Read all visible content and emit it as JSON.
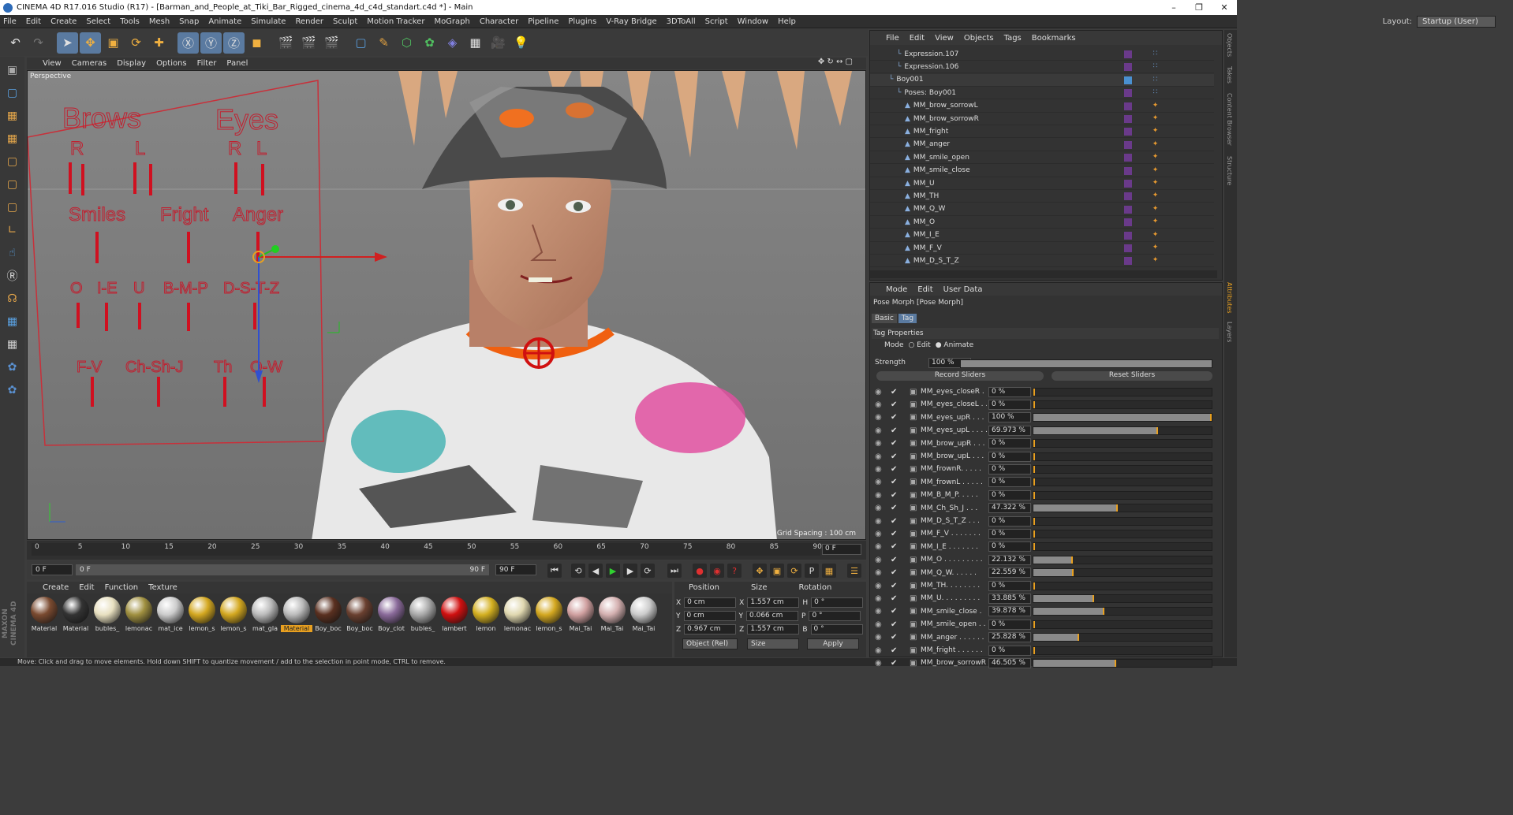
{
  "window": {
    "title": "CINEMA 4D R17.016 Studio (R17) - [Barman_and_People_at_Tiki_Bar_Rigged_cinema_4d_c4d_standart.c4d *] - Main"
  },
  "menubar": [
    "File",
    "Edit",
    "Create",
    "Select",
    "Tools",
    "Mesh",
    "Snap",
    "Animate",
    "Simulate",
    "Render",
    "Sculpt",
    "Motion Tracker",
    "MoGraph",
    "Character",
    "Pipeline",
    "Plugins",
    "V-Ray Bridge",
    "3DToAll",
    "Script",
    "Window",
    "Help"
  ],
  "layout": {
    "label": "Layout:",
    "value": "Startup (User)"
  },
  "viewport": {
    "menu": [
      "View",
      "Cameras",
      "Display",
      "Options",
      "Filter",
      "Panel"
    ],
    "label": "Perspective",
    "grid_spacing": "Grid Spacing : 100 cm",
    "rig_labels": {
      "brows": "Brows",
      "eyes": "Eyes",
      "r1": "R",
      "l1": "L",
      "r2": "R",
      "l2": "L",
      "smiles": "Smiles",
      "fright": "Fright",
      "anger": "Anger",
      "o": "O",
      "ie": "I-E",
      "u": "U",
      "bmp": "B-M-P",
      "dstz": "D-S-T-Z",
      "fv": "F-V",
      "chshj": "Ch-Sh-J",
      "th": "Th",
      "qw": "Q-W"
    }
  },
  "timeline": {
    "ticks": [
      "0",
      "5",
      "10",
      "15",
      "20",
      "25",
      "30",
      "35",
      "40",
      "45",
      "50",
      "55",
      "60",
      "65",
      "70",
      "75",
      "80",
      "85",
      "90"
    ],
    "current": "0 F"
  },
  "transport": {
    "start": "0 F",
    "range_start": "0 F",
    "range_end": "90 F",
    "end": "90 F"
  },
  "materials": {
    "menu": [
      "Create",
      "Edit",
      "Function",
      "Texture"
    ],
    "row1": [
      {
        "name": "Material",
        "color": "#7a4a30"
      },
      {
        "name": "Material",
        "color": "#333"
      },
      {
        "name": "bubles_",
        "color": "#e8e0c0"
      },
      {
        "name": "lemonac",
        "color": "#a09040"
      },
      {
        "name": "mat_ice",
        "color": "#ccc"
      },
      {
        "name": "lemon_s",
        "color": "#d4a820"
      },
      {
        "name": "lemon_s",
        "color": "#d4a820"
      },
      {
        "name": "mat_gla",
        "color": "#bbb"
      },
      {
        "name": "Material",
        "color": "#bbb"
      },
      {
        "name": "Boy_boc",
        "color": "#5a3020"
      },
      {
        "name": "Boy_boc",
        "color": "#6a4030"
      },
      {
        "name": "Boy_clot",
        "color": "#8a6a9a"
      },
      {
        "name": "bubles_",
        "color": "#aaa"
      },
      {
        "name": "lambert",
        "color": "#d01010"
      },
      {
        "name": "lemon",
        "color": "#d4b020"
      },
      {
        "name": "lemonac",
        "color": "#e0d8b0"
      },
      {
        "name": "lemon_s",
        "color": "#d4a820"
      },
      {
        "name": "Mai_Tai",
        "color": "#d0a0a0"
      },
      {
        "name": "Mai_Tai",
        "color": "#d4b0b0"
      },
      {
        "name": "Mai_Tai",
        "color": "#ccc"
      }
    ],
    "highlight_index": 8
  },
  "coords": {
    "headers": [
      "Position",
      "Size",
      "Rotation"
    ],
    "rows": [
      {
        "axis": "X",
        "pos": "0 cm",
        "saxis": "X",
        "size": "1.557 cm",
        "raxis": "H",
        "rot": "0 °"
      },
      {
        "axis": "Y",
        "pos": "0 cm",
        "saxis": "Y",
        "size": "0.066 cm",
        "raxis": "P",
        "rot": "0 °"
      },
      {
        "axis": "Z",
        "pos": "0.967 cm",
        "saxis": "Z",
        "size": "1.557 cm",
        "raxis": "B",
        "rot": "0 °"
      }
    ],
    "mode": "Object (Rel)",
    "size_mode": "Size",
    "apply": "Apply"
  },
  "status": "Move: Click and drag to move elements. Hold down SHIFT to quantize movement / add to the selection in point mode, CTRL to remove.",
  "objects": {
    "menu": [
      "File",
      "Edit",
      "View",
      "Objects",
      "Tags",
      "Bookmarks"
    ],
    "rows": [
      {
        "name": "Expression.107",
        "indent": 2
      },
      {
        "name": "Expression.106",
        "indent": 2
      },
      {
        "name": "Boy001",
        "indent": 1
      },
      {
        "name": "Poses: Boy001",
        "indent": 2
      },
      {
        "name": "MM_brow_sorrowL",
        "indent": 3
      },
      {
        "name": "MM_brow_sorrowR",
        "indent": 3
      },
      {
        "name": "MM_fright",
        "indent": 3
      },
      {
        "name": "MM_anger",
        "indent": 3
      },
      {
        "name": "MM_smile_open",
        "indent": 3
      },
      {
        "name": "MM_smile_close",
        "indent": 3
      },
      {
        "name": "MM_U",
        "indent": 3
      },
      {
        "name": "MM_TH",
        "indent": 3
      },
      {
        "name": "MM_Q_W",
        "indent": 3
      },
      {
        "name": "MM_O",
        "indent": 3
      },
      {
        "name": "MM_I_E",
        "indent": 3
      },
      {
        "name": "MM_F_V",
        "indent": 3
      },
      {
        "name": "MM_D_S_T_Z",
        "indent": 3
      }
    ]
  },
  "attributes": {
    "menu": [
      "Mode",
      "Edit",
      "User Data"
    ],
    "title": "Pose Morph [Pose Morph]",
    "tabs": [
      "Basic",
      "Tag"
    ],
    "section": "Tag Properties",
    "mode_label": "Mode",
    "mode_edit": "Edit",
    "mode_animate": "Animate",
    "strength_label": "Strength",
    "strength": "100 %",
    "record": "Record Sliders",
    "reset": "Reset Sliders",
    "sliders": [
      {
        "name": "MM_eyes_closeR . .",
        "value": "0 %",
        "frac": 0
      },
      {
        "name": "MM_eyes_closeL . .",
        "value": "0 %",
        "frac": 0
      },
      {
        "name": "MM_eyes_upR . . . .",
        "value": "100 %",
        "frac": 1
      },
      {
        "name": "MM_eyes_upL . . . .",
        "value": "69.973 %",
        "frac": 0.69973
      },
      {
        "name": "MM_brow_upR . . .",
        "value": "0 %",
        "frac": 0
      },
      {
        "name": "MM_brow_upL . . .",
        "value": "0 %",
        "frac": 0
      },
      {
        "name": "MM_frownR. . . . .",
        "value": "0 %",
        "frac": 0
      },
      {
        "name": "MM_frownL . . . . .",
        "value": "0 %",
        "frac": 0
      },
      {
        "name": "MM_B_M_P. . . . .",
        "value": "0 %",
        "frac": 0
      },
      {
        "name": "MM_Ch_Sh_J . . .",
        "value": "47.322 %",
        "frac": 0.47322
      },
      {
        "name": "MM_D_S_T_Z . . .",
        "value": "0 %",
        "frac": 0
      },
      {
        "name": "MM_F_V . . . . . . .",
        "value": "0 %",
        "frac": 0
      },
      {
        "name": "MM_I_E . . . . . . .",
        "value": "0 %",
        "frac": 0
      },
      {
        "name": "MM_O . . . . . . . . .",
        "value": "22.132 %",
        "frac": 0.22132
      },
      {
        "name": "MM_Q_W. . . . . .",
        "value": "22.559 %",
        "frac": 0.22559
      },
      {
        "name": "MM_TH. . . . . . . .",
        "value": "0 %",
        "frac": 0
      },
      {
        "name": "MM_U. . . . . . . . .",
        "value": "33.885 %",
        "frac": 0.33885
      },
      {
        "name": "MM_smile_close .",
        "value": "39.878 %",
        "frac": 0.39878
      },
      {
        "name": "MM_smile_open . .",
        "value": "0 %",
        "frac": 0
      },
      {
        "name": "MM_anger . . . . . .",
        "value": "25.828 %",
        "frac": 0.25828
      },
      {
        "name": "MM_fright . . . . . .",
        "value": "0 %",
        "frac": 0
      },
      {
        "name": "MM_brow_sorrowR",
        "value": "46.505 %",
        "frac": 0.46505
      }
    ]
  },
  "side_tabs": [
    "Objects",
    "Takes",
    "Content Browser",
    "Structure",
    "Attributes",
    "Layers"
  ]
}
